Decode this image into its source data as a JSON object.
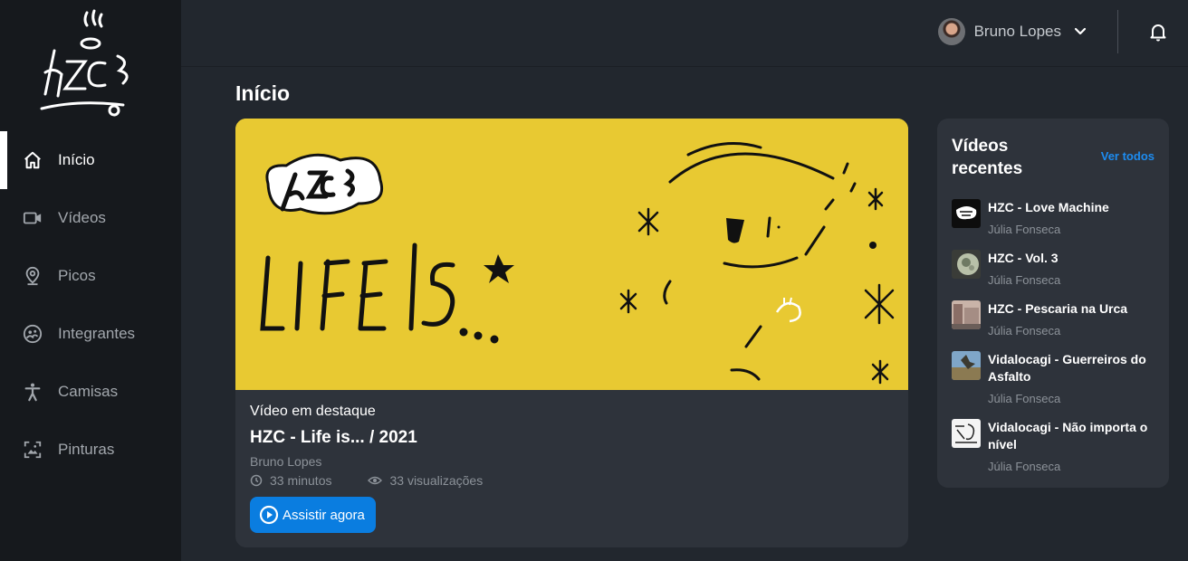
{
  "sidebar": {
    "items": [
      {
        "label": "Início",
        "icon": "home-icon",
        "active": true
      },
      {
        "label": "Vídeos",
        "icon": "video-camera-icon"
      },
      {
        "label": "Picos",
        "icon": "map-pin-icon"
      },
      {
        "label": "Integrantes",
        "icon": "group-icon"
      },
      {
        "label": "Camisas",
        "icon": "person-icon"
      },
      {
        "label": "Pinturas",
        "icon": "image-icon"
      }
    ]
  },
  "header": {
    "user_name": "Bruno Lopes"
  },
  "page": {
    "title": "Início"
  },
  "featured": {
    "label": "Vídeo em destaque",
    "title": "HZC - Life is... / 2021",
    "author": "Bruno Lopes",
    "duration": "33 minutos",
    "views": "33 visualizações",
    "button_label": "Assistir agora"
  },
  "recent": {
    "title": "Vídeos recentes",
    "see_all": "Ver todos",
    "items": [
      {
        "title": "HZC - Love Machine",
        "author": "Júlia Fonseca"
      },
      {
        "title": "HZC - Vol. 3",
        "author": "Júlia Fonseca"
      },
      {
        "title": "HZC - Pescaria na Urca",
        "author": "Júlia Fonseca"
      },
      {
        "title": "Vidalocagi - Guerreiros do Asfalto",
        "author": "Júlia Fonseca"
      },
      {
        "title": "Vidalocagi - Não importa o nível",
        "author": "Júlia Fonseca"
      }
    ]
  },
  "colors": {
    "sidebar_bg": "#16191d",
    "page_bg": "#22272e",
    "card_bg": "#2e333b",
    "banner_yellow": "#e8c932",
    "accent_blue": "#0a7de0",
    "link_blue": "#1d8cf0"
  }
}
